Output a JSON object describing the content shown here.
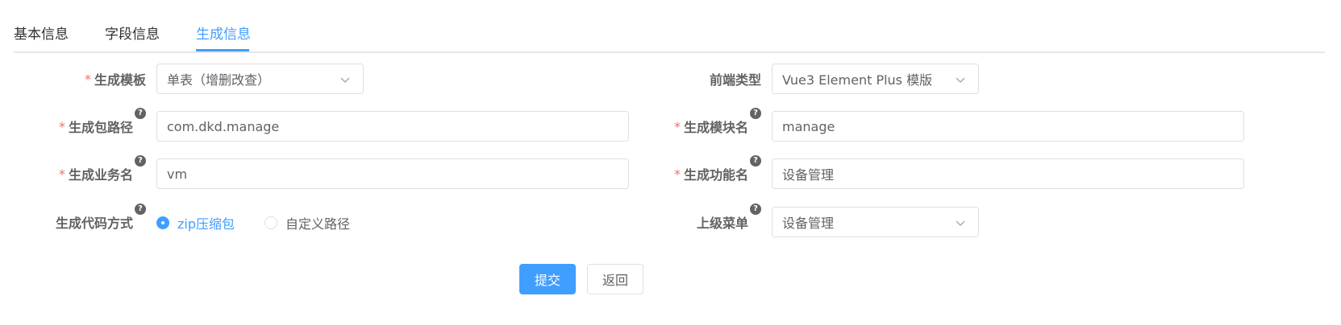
{
  "tabs": [
    {
      "label": "基本信息"
    },
    {
      "label": "字段信息"
    },
    {
      "label": "生成信息"
    }
  ],
  "active_tab": "生成信息",
  "accent_color": "#409eff",
  "required_mark": "*",
  "help_mark": "?",
  "form": {
    "tpl_category": {
      "label": "生成模板",
      "value": "单表（增删改查）"
    },
    "frontend_type": {
      "label": "前端类型",
      "value": "Vue3 Element Plus 模版"
    },
    "package_name": {
      "label": "生成包路径",
      "value": "com.dkd.manage"
    },
    "module_name": {
      "label": "生成模块名",
      "value": "manage"
    },
    "business_name": {
      "label": "生成业务名",
      "value": "vm"
    },
    "function_name": {
      "label": "生成功能名",
      "value": "设备管理"
    },
    "gen_type": {
      "label": "生成代码方式",
      "options": [
        "zip压缩包",
        "自定义路径"
      ],
      "selected": "zip压缩包"
    },
    "parent_menu": {
      "label": "上级菜单",
      "value": "设备管理"
    }
  },
  "buttons": {
    "submit": "提交",
    "back": "返回"
  }
}
